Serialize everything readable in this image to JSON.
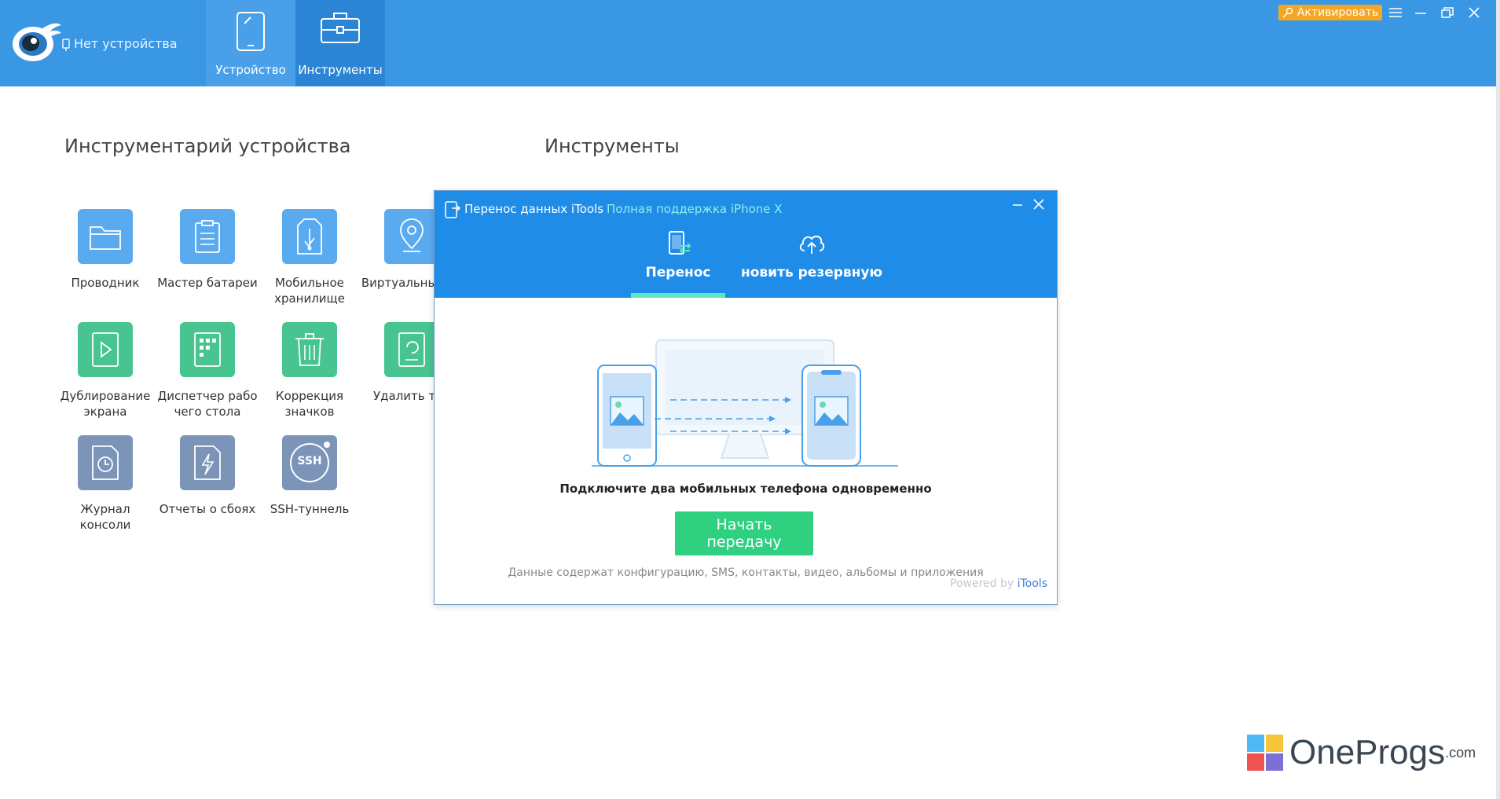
{
  "header": {
    "device_status": "Нет устройства",
    "tabs": [
      {
        "label": "Устройство",
        "icon": "tablet-icon"
      },
      {
        "label": "Инструменты",
        "icon": "toolbox-icon"
      }
    ],
    "activate_label": "Активировать"
  },
  "sections": {
    "device_tools_title": "Инструментарий устройства",
    "tools_title": "Инструменты"
  },
  "tools": [
    {
      "label": "Проводник",
      "icon": "folder-icon",
      "color": "#5aaaf0"
    },
    {
      "label": "Мастер батареи",
      "icon": "clipboard-icon",
      "color": "#5aaaf0"
    },
    {
      "label": "Мобильное хранилище",
      "icon": "usb-storage-icon",
      "color": "#5aaaf0"
    },
    {
      "label": "Виртуальны рес",
      "icon": "location-pin-icon",
      "color": "#5aaaf0"
    },
    {
      "label": "Дублирование экрана",
      "icon": "play-icon",
      "color": "#47c48f"
    },
    {
      "label": "Диспетчер рабо чего стола",
      "icon": "grid-icon",
      "color": "#47c48f"
    },
    {
      "label": "Коррекция значков",
      "icon": "trash-icon",
      "color": "#47c48f"
    },
    {
      "label": "Удалить тел",
      "icon": "refresh-device-icon",
      "color": "#47c48f"
    },
    {
      "label": "Журнал консоли",
      "icon": "clock-file-icon",
      "color": "#7b94b8"
    },
    {
      "label": "Отчеты о сбоях",
      "icon": "lightning-file-icon",
      "color": "#7b94b8"
    },
    {
      "label": "SSH-туннель",
      "icon": "ssh-icon",
      "color": "#7b94b8",
      "badge_text": "SSH"
    }
  ],
  "dialog": {
    "title": "Перенос данных iTools",
    "support": "Полная поддержка iPhone X",
    "tabs": [
      {
        "label": "Перенос",
        "icon": "phone-transfer-icon"
      },
      {
        "label": "новить резервную",
        "icon": "cloud-upload-icon"
      }
    ],
    "connect_text": "Подключите два мобильных телефона одновременно",
    "start_button": "Начать передачу",
    "description": "Данные содержат конфигурацию, SMS, контакты, видео, альбомы и приложения",
    "powered_prefix": "Powered by",
    "powered_brand": "iTools"
  },
  "watermark": {
    "text": "OneProgs",
    "suffix": ".com"
  },
  "colors": {
    "header_bg": "#3a97e4",
    "dialog_header_bg": "#1f8de8",
    "accent_green": "#2fd07f",
    "activate_bg": "#f5a623"
  }
}
